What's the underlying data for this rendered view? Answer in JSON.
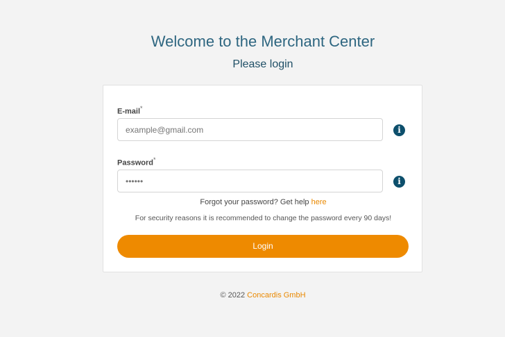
{
  "header": {
    "title": "Welcome to the Merchant Center",
    "subtitle": "Please login"
  },
  "form": {
    "email": {
      "label": "E-mail",
      "required_marker": "*",
      "placeholder": "example@gmail.com",
      "value": ""
    },
    "password": {
      "label": "Password",
      "required_marker": "*",
      "placeholder": "••••••",
      "value": ""
    },
    "forgot_text": "Forgot your password? Get help",
    "forgot_link": "here",
    "security_notice": "For security reasons it is recommended to change the password every 90 days!",
    "login_label": "Login"
  },
  "footer": {
    "copyright": "© 2022",
    "company": "Concardis GmbH"
  },
  "colors": {
    "accent": "#ee8a00",
    "title": "#2e6680",
    "info_icon": "#0d4f6c",
    "background": "#f3f3f3"
  },
  "icons": {
    "email_info": "info-circle-icon",
    "password_info": "info-circle-icon"
  }
}
